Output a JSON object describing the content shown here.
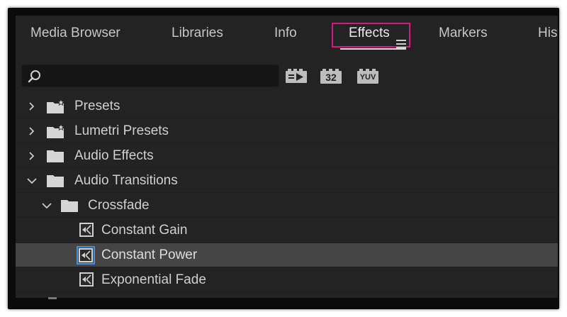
{
  "tabs": [
    {
      "label": "Media Browser"
    },
    {
      "label": "Libraries"
    },
    {
      "label": "Info"
    },
    {
      "label": "Effects"
    },
    {
      "label": "Markers"
    },
    {
      "label": "Hist"
    }
  ],
  "active_tab": "Effects",
  "search": {
    "value": "",
    "placeholder": ""
  },
  "toolbar": {
    "accelerated_label": "",
    "bit32_label": "32",
    "yuv_label": "YUV"
  },
  "tree": [
    {
      "label": "Presets",
      "icon": "star-folder-icon",
      "expanded": false
    },
    {
      "label": "Lumetri Presets",
      "icon": "star-folder-icon",
      "expanded": false
    },
    {
      "label": "Audio Effects",
      "icon": "folder-icon",
      "expanded": false
    },
    {
      "label": "Audio Transitions",
      "icon": "folder-icon",
      "expanded": true
    },
    {
      "label": "Crossfade",
      "icon": "folder-icon",
      "expanded": true
    },
    {
      "label": "Constant Gain",
      "icon": "audio-transition-icon"
    },
    {
      "label": "Constant Power",
      "icon": "audio-transition-icon",
      "selected": true
    },
    {
      "label": "Exponential Fade",
      "icon": "audio-transition-icon"
    }
  ],
  "colors": {
    "panel_bg": "#232323",
    "highlight_box": "#d11c7b",
    "selected_row": "#454545",
    "selected_icon_border": "#4a8fd6"
  }
}
